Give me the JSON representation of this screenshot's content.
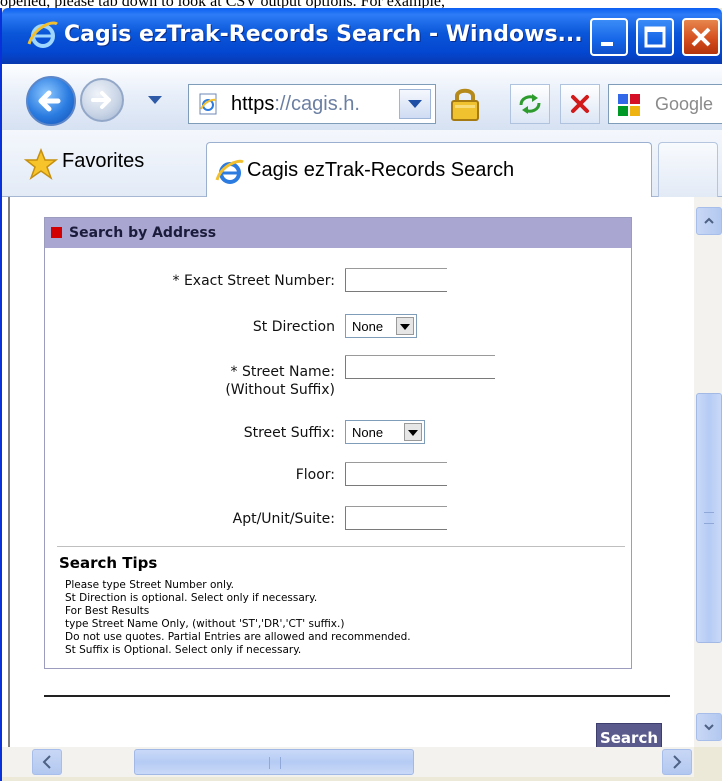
{
  "top_caption": "opened, please tab down to look at CSV output options. For example,",
  "window": {
    "title": "Cagis ezTrak-Records Search - Windows..."
  },
  "navbar": {
    "address_scheme": "https",
    "address_rest": "://cagis.h.",
    "search_placeholder": "Google"
  },
  "favorites": {
    "label": "Favorites",
    "tab_label": "Cagis ezTrak-Records Search"
  },
  "panel": {
    "title": "Search by Address",
    "fields": {
      "street_number_label": "* Exact Street Number:",
      "street_number_value": "",
      "direction_label": "St Direction",
      "direction_value": "None",
      "street_name_label": "* Street Name:",
      "street_name_sub": "(Without Suffix)",
      "street_name_value": "",
      "suffix_label": "Street Suffix:",
      "suffix_value": "None",
      "floor_label": "Floor:",
      "floor_value": "",
      "apt_label": "Apt/Unit/Suite:",
      "apt_value": ""
    },
    "tips_title": "Search Tips",
    "tips": [
      "Please type Street Number only.",
      "St Direction is optional. Select only if necessary.",
      "For Best Results",
      "type Street Name Only, (without 'ST','DR','CT' suffix.)",
      "Do not use quotes. Partial Entries are allowed and recommended.",
      "St Suffix is Optional. Select only if necessary."
    ]
  },
  "search_button": "Search",
  "colors": {
    "titlebar": "#0A56D9",
    "panel_header": "#A9A6D2",
    "bullet": "#D20000",
    "search_button": "#5A5A8C"
  }
}
